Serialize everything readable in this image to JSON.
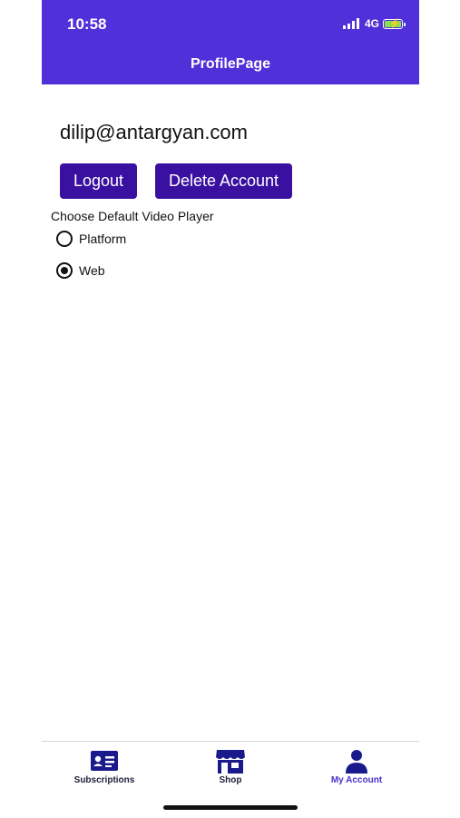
{
  "status_bar": {
    "time": "10:58",
    "network": "4G"
  },
  "header": {
    "title": "ProfilePage",
    "bg_color": "#5030d8"
  },
  "profile": {
    "email": "dilip@antargyan.com",
    "logout_label": "Logout",
    "delete_label": "Delete Account",
    "button_color": "#3a10a0"
  },
  "video_player": {
    "label": "Choose Default Video Player",
    "options": [
      {
        "label": "Platform",
        "selected": false
      },
      {
        "label": "Web",
        "selected": true
      }
    ]
  },
  "tabs": [
    {
      "label": "Subscriptions",
      "icon": "id-card-icon",
      "active": false
    },
    {
      "label": "Shop",
      "icon": "store-icon",
      "active": false
    },
    {
      "label": "My Account",
      "icon": "person-icon",
      "active": true
    }
  ]
}
